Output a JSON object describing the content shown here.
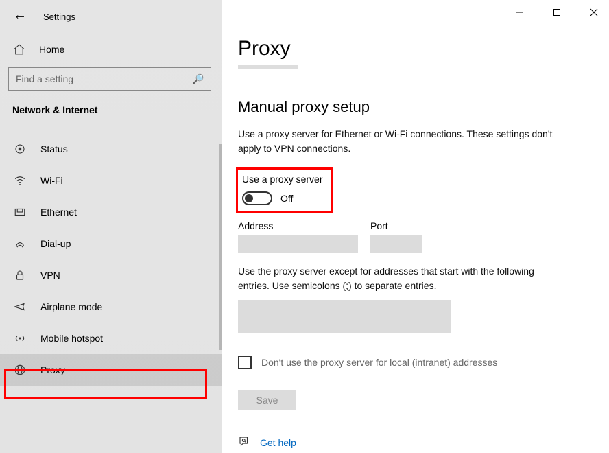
{
  "window": {
    "app_name": "Settings"
  },
  "sidebar": {
    "home_label": "Home",
    "search_placeholder": "Find a setting",
    "section_heading": "Network & Internet",
    "items": [
      {
        "label": "Status"
      },
      {
        "label": "Wi-Fi"
      },
      {
        "label": "Ethernet"
      },
      {
        "label": "Dial-up"
      },
      {
        "label": "VPN"
      },
      {
        "label": "Airplane mode"
      },
      {
        "label": "Mobile hotspot"
      },
      {
        "label": "Proxy"
      }
    ]
  },
  "page": {
    "title": "Proxy",
    "subheading": "Manual proxy setup",
    "description": "Use a proxy server for Ethernet or Wi-Fi connections. These settings don't apply to VPN connections.",
    "toggle_label": "Use a proxy server",
    "toggle_state": "Off",
    "address_label": "Address",
    "address_value": "",
    "port_label": "Port",
    "port_value": "",
    "exceptions_label": "Use the proxy server except for addresses that start with the following entries. Use semicolons (;) to separate entries.",
    "exceptions_value": "",
    "local_bypass_label": "Don't use the proxy server for local (intranet) addresses",
    "save_label": "Save",
    "help_label": "Get help"
  }
}
